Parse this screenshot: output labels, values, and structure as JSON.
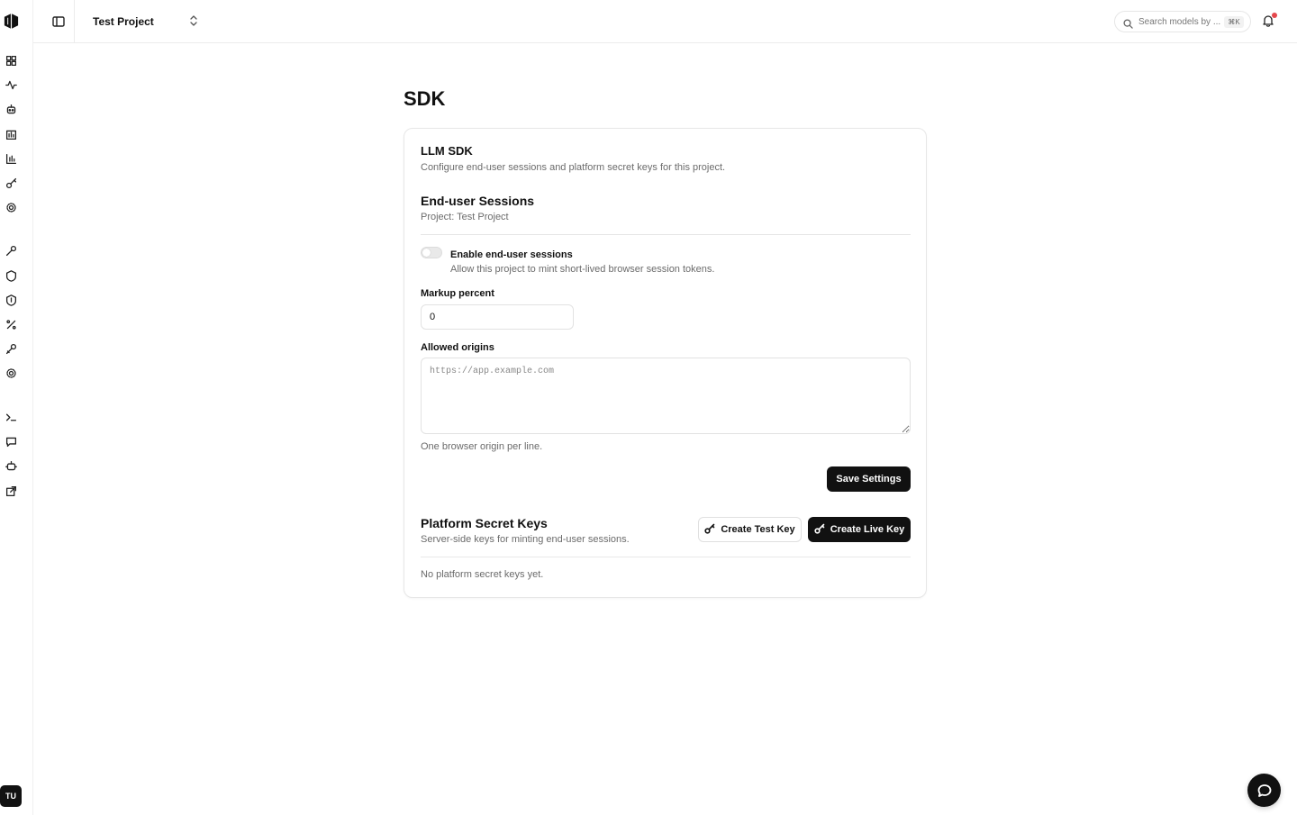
{
  "app": {
    "user_initials": "TU"
  },
  "rail": {
    "icons": [
      "dashboard-icon",
      "activity-icon",
      "robot-icon",
      "bar-chart-icon",
      "chart-icon",
      "key-icon",
      "settings-icon",
      "wrench-icon",
      "shield-icon",
      "shield-check-icon",
      "percent-icon",
      "tool-icon",
      "gear-icon",
      "terminal-icon",
      "message-icon",
      "bot-icon",
      "external-link-icon"
    ]
  },
  "topbar": {
    "project_name": "Test Project",
    "search_placeholder": "Search models by ...",
    "search_shortcut": "⌘K",
    "has_notification": true
  },
  "page": {
    "title": "SDK"
  },
  "sdk_card": {
    "title": "LLM SDK",
    "subtitle": "Configure end-user sessions and platform secret keys for this project.",
    "sessions": {
      "title": "End-user Sessions",
      "project_line": "Project: Test Project",
      "toggle_label": "Enable end-user sessions",
      "toggle_help": "Allow this project to mint short-lived browser session tokens.",
      "toggle_enabled": false
    },
    "markup": {
      "label": "Markup percent",
      "value": "0"
    },
    "origins": {
      "label": "Allowed origins",
      "placeholder": "https://app.example.com",
      "value": "",
      "help": "One browser origin per line."
    },
    "save_label": "Save Settings",
    "keys": {
      "title": "Platform Secret Keys",
      "subtitle": "Server-side keys for minting end-user sessions.",
      "create_test_label": "Create Test Key",
      "create_live_label": "Create Live Key",
      "empty_text": "No platform secret keys yet."
    }
  },
  "colors": {
    "primary": "#111111",
    "muted_text": "#6b6b6b",
    "border": "#e7e7e7",
    "notification": "#e5484d"
  }
}
